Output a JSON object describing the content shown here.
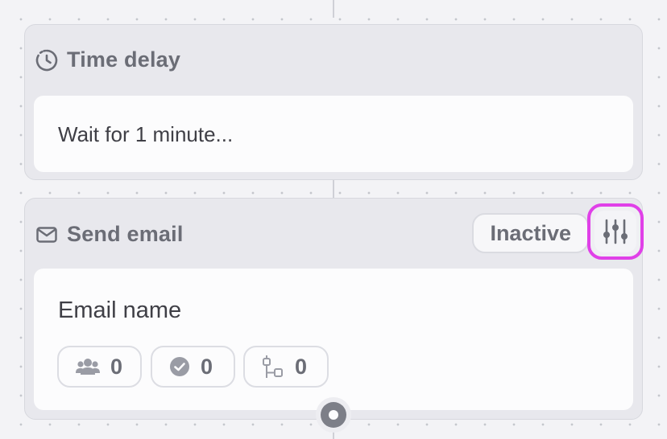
{
  "nodes": {
    "time_delay": {
      "title": "Time delay",
      "icon": "clock-icon",
      "body_text": "Wait for 1 minute..."
    },
    "send_email": {
      "title": "Send email",
      "icon": "mail-icon",
      "status": "Inactive",
      "settings_icon": "sliders-icon",
      "email_name": "Email name",
      "stats": [
        {
          "icon": "users-icon",
          "value": "0"
        },
        {
          "icon": "check-circle-icon",
          "value": "0"
        },
        {
          "icon": "flow-icon",
          "value": "0"
        }
      ]
    }
  },
  "colors": {
    "canvas": "#f3f3f6",
    "card": "#e8e8ed",
    "card_body": "#fcfcfd",
    "highlight": "#e040e8",
    "muted_text": "#6b6d76"
  }
}
